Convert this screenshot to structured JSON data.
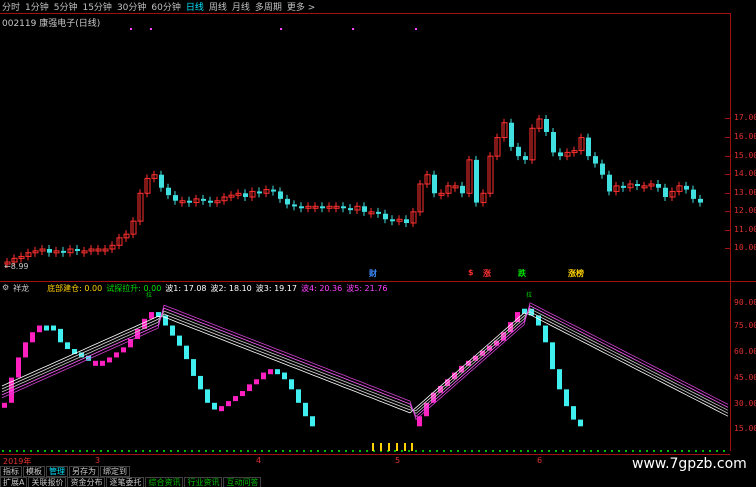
{
  "toolbar": {
    "items": [
      "分时",
      "1分钟",
      "5分钟",
      "15分钟",
      "30分钟",
      "60分钟",
      "日线",
      "周线",
      "月线",
      "多周期",
      "更多 >"
    ],
    "active_index": 6
  },
  "stock": {
    "title": "002119 康强电子(日线)"
  },
  "price_axis": [
    "17.00",
    "16.00",
    "15.00",
    "14.00",
    "13.00",
    "12.00",
    "11.00",
    "10.00"
  ],
  "low_label": "←8.99",
  "event_markers": [
    {
      "text": "财",
      "color": "#3c8cff"
    },
    {
      "text": "$",
      "color": "#ff3030"
    },
    {
      "text": "涨",
      "color": "#ff3030"
    },
    {
      "text": "跌",
      "color": "#00e000"
    },
    {
      "text": "涨榜",
      "color": "#ffd000"
    }
  ],
  "indicator": {
    "name": "祥龙",
    "label_bottom": "底部建仓: 0.00",
    "label_trial": "试探拉升: 0.00",
    "waves": [
      {
        "label": "波1: 17.08",
        "color": "#ffffff"
      },
      {
        "label": "波2: 18.10",
        "color": "#ffffff"
      },
      {
        "label": "波3: 19.17",
        "color": "#ffffff"
      },
      {
        "label": "波4: 20.36",
        "color": "#ff40ff"
      },
      {
        "label": "波5: 21.76",
        "color": "#ff40ff"
      }
    ],
    "axis": [
      "90.00",
      "75.00",
      "60.00",
      "45.00",
      "30.00",
      "15.00"
    ]
  },
  "signal_label": "拉",
  "dates": [
    "2019年",
    "3",
    "4",
    "5",
    "6"
  ],
  "tabs_row1": [
    "指标",
    "模板",
    "管理",
    "另存为",
    "绑定到"
  ],
  "tabs_row2": [
    "扩展A",
    "关联报价",
    "资金分布",
    "逐笔委托",
    "综合资讯",
    "行业资讯",
    "互动问答"
  ],
  "watermark": "www.7gpzb.com",
  "colors": {
    "up": "#ff3030",
    "down": "#40e0e0",
    "axis": "#a01010",
    "pink": "#ff20c0",
    "cyan": "#40f0f0"
  }
}
